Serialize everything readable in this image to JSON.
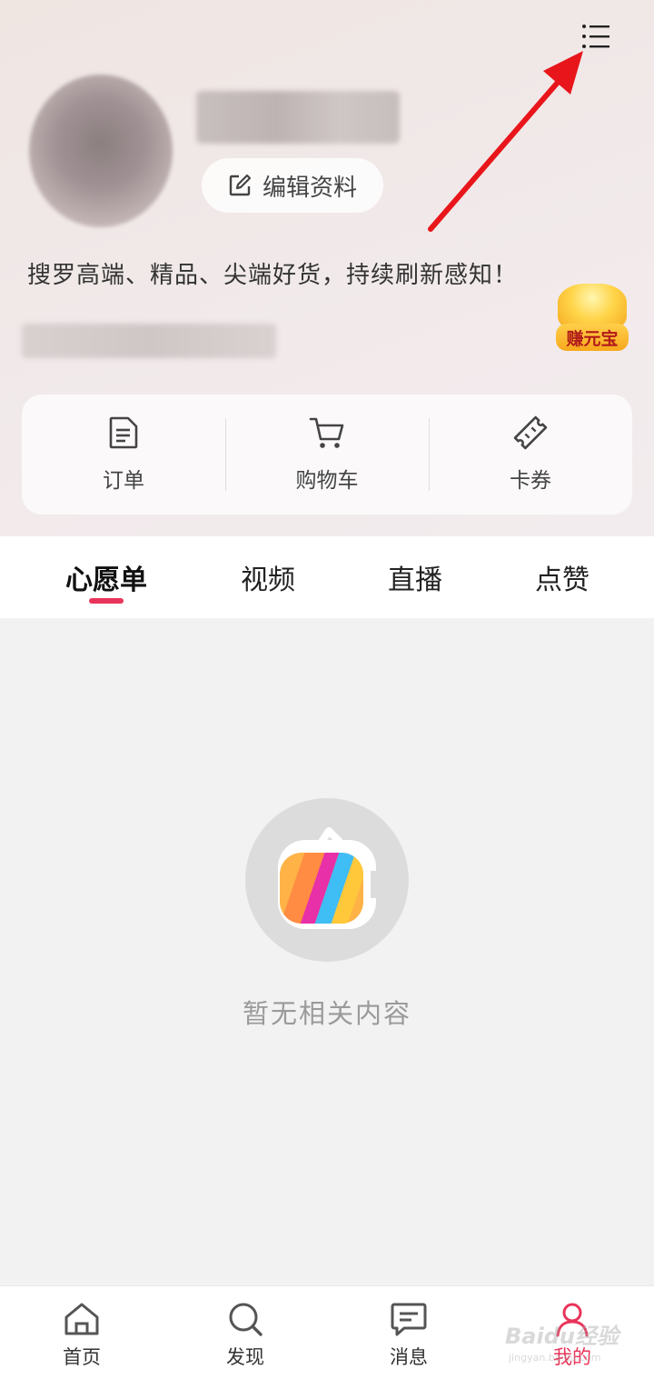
{
  "header": {
    "edit_profile_label": "编辑资料",
    "slogan": "搜罗高端、精品、尖端好货，持续刷新感知！",
    "earn_badge_label": "赚元宝",
    "menu_icon": "list-menu-icon"
  },
  "quick_actions": [
    {
      "label": "订单",
      "icon": "order-document-icon"
    },
    {
      "label": "购物车",
      "icon": "shopping-cart-icon"
    },
    {
      "label": "卡券",
      "icon": "ticket-coupon-icon"
    }
  ],
  "tabs": [
    {
      "label": "心愿单",
      "active": true
    },
    {
      "label": "视频",
      "active": false
    },
    {
      "label": "直播",
      "active": false
    },
    {
      "label": "点赞",
      "active": false
    }
  ],
  "empty_state": {
    "message": "暂无相关内容",
    "icon": "tv-logo-icon"
  },
  "bottom_nav": [
    {
      "label": "首页",
      "icon": "home-icon",
      "active": false
    },
    {
      "label": "发现",
      "icon": "search-icon",
      "active": false
    },
    {
      "label": "消息",
      "icon": "message-icon",
      "active": false
    },
    {
      "label": "我的",
      "icon": "profile-icon",
      "active": true
    }
  ],
  "watermark": {
    "text": "Baidu经验",
    "subtext": "jingyan.baidu.com"
  },
  "colors": {
    "accent": "#e8345a",
    "arrow": "#e8161b",
    "header_bg": "#efe7e6",
    "content_bg": "#f2f2f2"
  }
}
